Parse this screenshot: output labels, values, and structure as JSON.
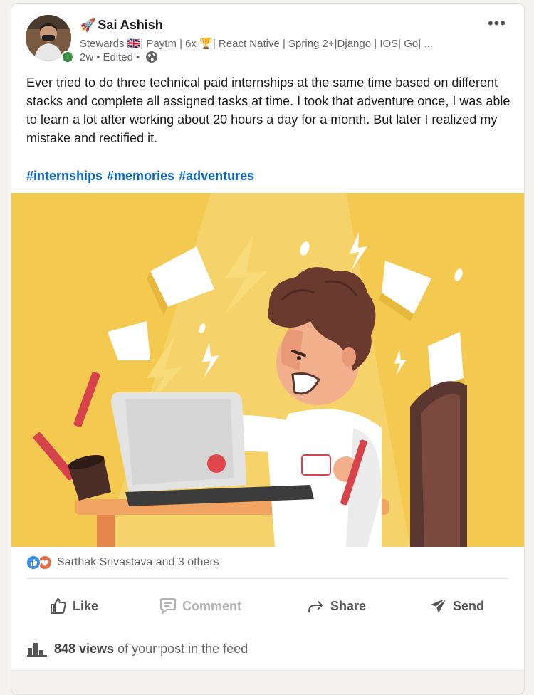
{
  "post": {
    "author": {
      "rocket_emoji": "🚀",
      "name": "Sai Ashish",
      "headline": "Stewards 🇬🇧| Paytm | 6x 🏆| React Native | Spring 2+|Django | IOS| Go| ...",
      "time": "2w",
      "edited": "Edited",
      "visibility_icon": "globe-icon",
      "online_status_color": "#3a8d3f"
    },
    "more_label": "•••",
    "text": "Ever tried to do three technical paid internships at the same time based on different stacks and complete all assigned tasks at time. I took that adventure once, I was able to learn a lot after working about 20 hours a day for a month. But later I realized my mistake and rectified it.",
    "hashtags": [
      "#internships",
      "#memories",
      "#adventures"
    ],
    "image_background": "#f3c94f",
    "reactions": {
      "icons": [
        "like-reaction-icon",
        "love-reaction-icon"
      ],
      "text": "Sarthak Srivastava and 3 others"
    },
    "actions": {
      "like": "Like",
      "comment": "Comment",
      "share": "Share",
      "send": "Send"
    },
    "views": {
      "count": "848 views",
      "suffix": "of your post in the feed"
    }
  },
  "colors": {
    "link": "#0a66c2",
    "like_reaction": "#378fe9",
    "love_reaction": "#df704d"
  }
}
